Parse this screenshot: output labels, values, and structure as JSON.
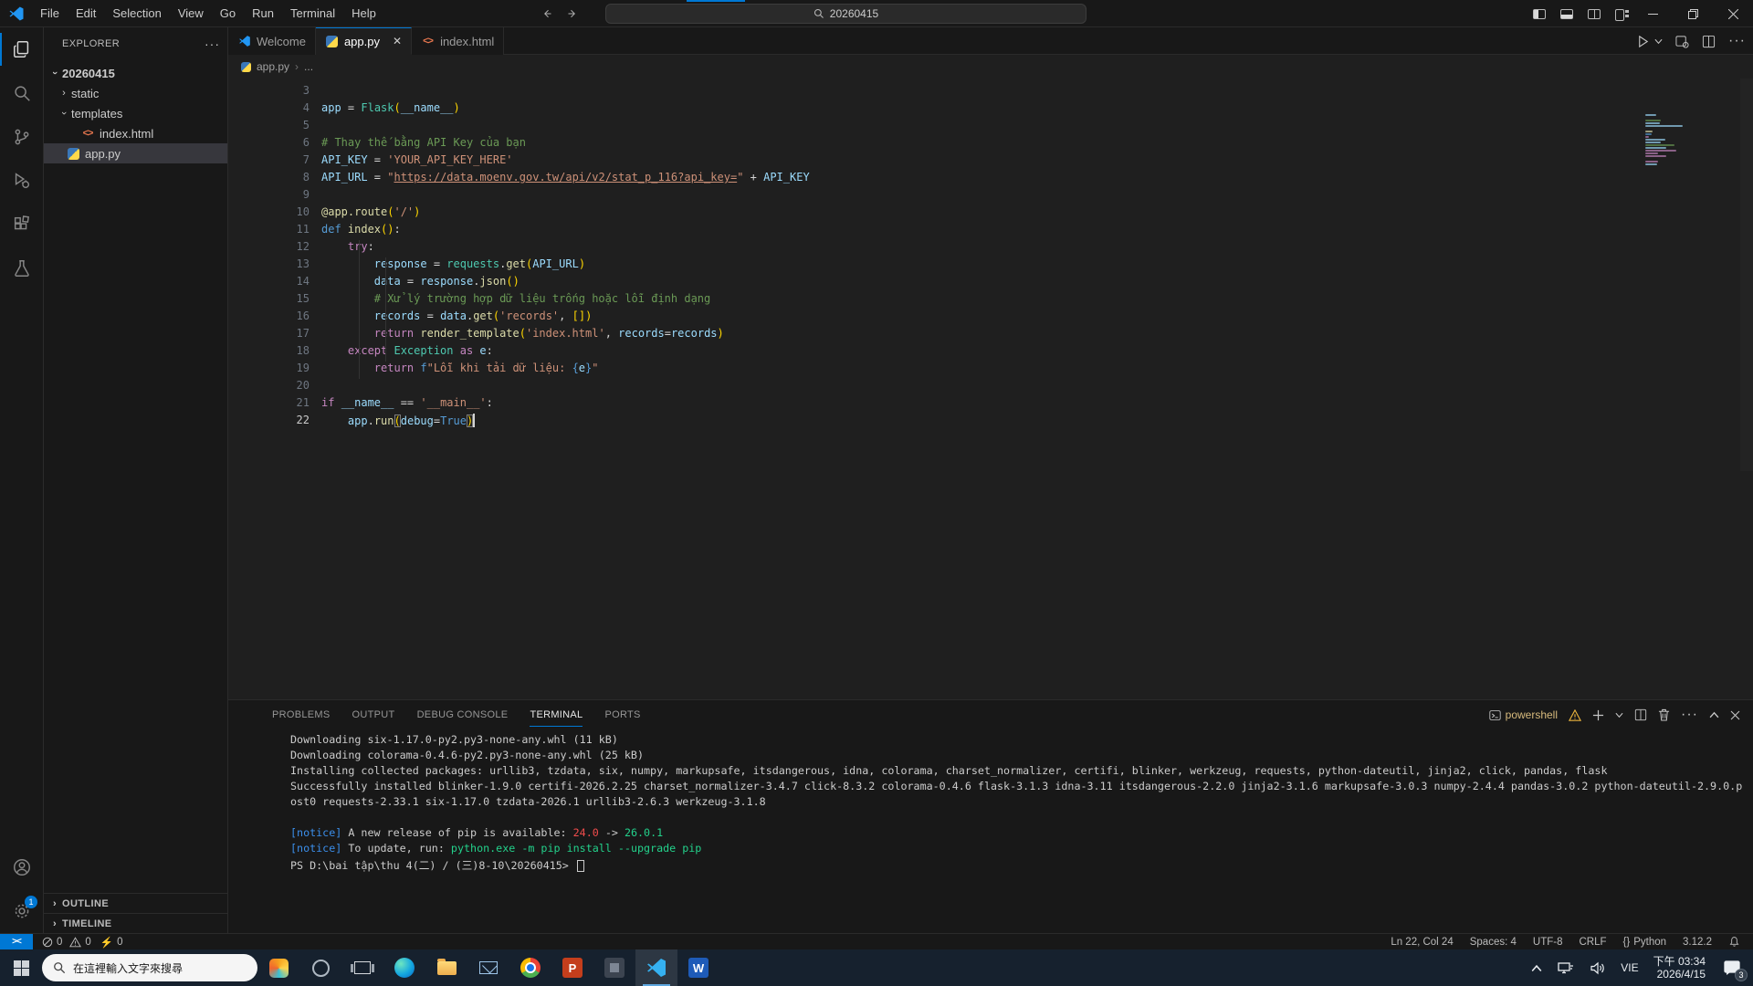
{
  "titlebar": {
    "menus": [
      "File",
      "Edit",
      "Selection",
      "View",
      "Go",
      "Run",
      "Terminal",
      "Help"
    ],
    "command_center_text": "20260415"
  },
  "tabs": [
    {
      "label": "Welcome",
      "icon": "vscode-logo"
    },
    {
      "label": "app.py",
      "icon": "python",
      "active": true
    },
    {
      "label": "index.html",
      "icon": "html"
    }
  ],
  "breadcrumb": {
    "file": "app.py",
    "separator": "›",
    "ellipsis": "..."
  },
  "explorer": {
    "title": "EXPLORER",
    "more": "···",
    "items": [
      {
        "label": "20260415"
      },
      {
        "label": "static"
      },
      {
        "label": "templates"
      },
      {
        "label": "index.html"
      },
      {
        "label": "app.py"
      }
    ]
  },
  "sidebar_sections": {
    "outline": "OUTLINE",
    "timeline": "TIMELINE"
  },
  "editor": {
    "lines": [
      {
        "n": 3,
        "segs": []
      },
      {
        "n": 4,
        "segs": [
          [
            "app",
            "v"
          ],
          [
            " = ",
            "o"
          ],
          [
            "Flask",
            "c"
          ],
          [
            "(",
            "b"
          ],
          [
            "__name__",
            "v"
          ],
          [
            ")",
            "b"
          ]
        ]
      },
      {
        "n": 5,
        "segs": []
      },
      {
        "n": 6,
        "segs": [
          [
            "# Thay thế bằng API Key của bạn",
            "m"
          ]
        ]
      },
      {
        "n": 7,
        "segs": [
          [
            "API_KEY",
            "v"
          ],
          [
            " = ",
            "o"
          ],
          [
            "'YOUR_API_KEY_HERE'",
            "s"
          ]
        ]
      },
      {
        "n": 8,
        "segs": [
          [
            "API_URL",
            "v"
          ],
          [
            " = ",
            "o"
          ],
          [
            "\"",
            "s"
          ],
          [
            "https://data.moenv.gov.tw/api/v2/stat_p_116?api_key=",
            "u"
          ],
          [
            "\"",
            "s"
          ],
          [
            " + ",
            "o"
          ],
          [
            "API_KEY",
            "v"
          ]
        ]
      },
      {
        "n": 9,
        "segs": []
      },
      {
        "n": 10,
        "segs": [
          [
            "@app.route",
            "f"
          ],
          [
            "(",
            "b"
          ],
          [
            "'/'",
            "s"
          ],
          [
            ")",
            "b"
          ]
        ]
      },
      {
        "n": 11,
        "segs": [
          [
            "def ",
            "d"
          ],
          [
            "index",
            "f"
          ],
          [
            "(",
            "b"
          ],
          [
            ")",
            "b"
          ],
          [
            ":",
            "o"
          ]
        ]
      },
      {
        "n": 12,
        "segs": [
          [
            "    ",
            "o"
          ],
          [
            "try",
            "k"
          ],
          [
            ":",
            "o"
          ]
        ]
      },
      {
        "n": 13,
        "segs": [
          [
            "        ",
            "o"
          ],
          [
            "response",
            "v"
          ],
          [
            " = ",
            "o"
          ],
          [
            "requests",
            "c"
          ],
          [
            ".",
            "o"
          ],
          [
            "get",
            "f"
          ],
          [
            "(",
            "b"
          ],
          [
            "API_URL",
            "v"
          ],
          [
            ")",
            "b"
          ]
        ]
      },
      {
        "n": 14,
        "segs": [
          [
            "        ",
            "o"
          ],
          [
            "data",
            "v"
          ],
          [
            " = ",
            "o"
          ],
          [
            "response",
            "v"
          ],
          [
            ".",
            "o"
          ],
          [
            "json",
            "f"
          ],
          [
            "(",
            "b"
          ],
          [
            ")",
            "b"
          ]
        ]
      },
      {
        "n": 15,
        "segs": [
          [
            "        ",
            "o"
          ],
          [
            "# Xử lý trường hợp dữ liệu trống hoặc lỗi định dạng",
            "m"
          ]
        ]
      },
      {
        "n": 16,
        "segs": [
          [
            "        ",
            "o"
          ],
          [
            "records",
            "v"
          ],
          [
            " = ",
            "o"
          ],
          [
            "data",
            "v"
          ],
          [
            ".",
            "o"
          ],
          [
            "get",
            "f"
          ],
          [
            "(",
            "b"
          ],
          [
            "'records'",
            "s"
          ],
          [
            ", ",
            "o"
          ],
          [
            "[]",
            "b"
          ],
          [
            ")",
            "b"
          ]
        ]
      },
      {
        "n": 17,
        "segs": [
          [
            "        ",
            "o"
          ],
          [
            "return ",
            "k"
          ],
          [
            "render_template",
            "f"
          ],
          [
            "(",
            "b"
          ],
          [
            "'index.html'",
            "s"
          ],
          [
            ", ",
            "o"
          ],
          [
            "records",
            "v"
          ],
          [
            "=",
            "o"
          ],
          [
            "records",
            "v"
          ],
          [
            ")",
            "b"
          ]
        ]
      },
      {
        "n": 18,
        "segs": [
          [
            "    ",
            "o"
          ],
          [
            "except ",
            "k"
          ],
          [
            "Exception",
            "c"
          ],
          [
            " as ",
            "k"
          ],
          [
            "e",
            "v"
          ],
          [
            ":",
            "o"
          ]
        ]
      },
      {
        "n": 19,
        "segs": [
          [
            "        ",
            "o"
          ],
          [
            "return ",
            "k"
          ],
          [
            "f",
            "d"
          ],
          [
            "\"Lỗi khi tải dữ liệu: ",
            "s"
          ],
          [
            "{",
            "d"
          ],
          [
            "e",
            "v"
          ],
          [
            "}",
            "d"
          ],
          [
            "\"",
            "s"
          ]
        ]
      },
      {
        "n": 20,
        "segs": []
      },
      {
        "n": 21,
        "segs": [
          [
            "if ",
            "k"
          ],
          [
            "__name__",
            "v"
          ],
          [
            " == ",
            "o"
          ],
          [
            "'__main__'",
            "s"
          ],
          [
            ":",
            "o"
          ]
        ]
      },
      {
        "n": 22,
        "cursor": true,
        "segs": [
          [
            "    ",
            "o"
          ],
          [
            "app",
            "v"
          ],
          [
            ".",
            "o"
          ],
          [
            "run",
            "f"
          ],
          [
            "(",
            "x"
          ],
          [
            "debug",
            "v"
          ],
          [
            "=",
            "o"
          ],
          [
            "True",
            "d"
          ],
          [
            ")",
            "x"
          ]
        ]
      }
    ]
  },
  "panel": {
    "tabs": [
      "PROBLEMS",
      "OUTPUT",
      "DEBUG CONSOLE",
      "TERMINAL",
      "PORTS"
    ],
    "active_tab": "TERMINAL",
    "shell_label": "powershell",
    "terminal_lines": [
      {
        "segs": [
          [
            "Downloading six-1.17.0-py2.py3-none-any.whl (11 kB)",
            "w"
          ]
        ]
      },
      {
        "segs": [
          [
            "Downloading colorama-0.4.6-py2.py3-none-any.whl (25 kB)",
            "w"
          ]
        ]
      },
      {
        "segs": [
          [
            "Installing collected packages: urllib3, tzdata, six, numpy, markupsafe, itsdangerous, idna, colorama, charset_normalizer, certifi, blinker, werkzeug, requests, python-dateutil, jinja2, click, pandas, flask",
            "w"
          ]
        ]
      },
      {
        "segs": [
          [
            "Successfully installed blinker-1.9.0 certifi-2026.2.25 charset_normalizer-3.4.7 click-8.3.2 colorama-0.4.6 flask-3.1.3 idna-3.11 itsdangerous-2.2.0 jinja2-3.1.6 markupsafe-3.0.3 numpy-2.4.4 pandas-3.0.2 python-dateutil-2.9.0.p",
            "w"
          ]
        ]
      },
      {
        "segs": [
          [
            "ost0 requests-2.33.1 six-1.17.0 tzdata-2026.1 urllib3-2.6.3 werkzeug-3.1.8",
            "w"
          ]
        ]
      },
      {
        "segs": []
      },
      {
        "segs": [
          [
            "[notice]",
            "b"
          ],
          [
            " A new release of pip is available: ",
            "w"
          ],
          [
            "24.0",
            "r"
          ],
          [
            " -> ",
            "w"
          ],
          [
            "26.0.1",
            "g"
          ]
        ]
      },
      {
        "segs": [
          [
            "[notice]",
            "b"
          ],
          [
            " To update, run: ",
            "w"
          ],
          [
            "python.exe -m pip install --upgrade pip",
            "g"
          ]
        ]
      },
      {
        "segs": [
          [
            "PS D:\\bai tập\\thu 4(二) / (三)8-10\\20260415> ",
            "w"
          ]
        ],
        "cursor": true
      }
    ]
  },
  "status": {
    "remote_glyph": "><",
    "errors": "0",
    "warnings": "0",
    "ports": "0",
    "line_col": "Ln 22, Col 24",
    "indentation": "Spaces: 4",
    "encoding": "UTF-8",
    "eol": "CRLF",
    "lang_icon": "{}",
    "language": "Python",
    "py_version": "3.12.2"
  },
  "taskbar": {
    "search_placeholder": "在這裡輸入文字來搜尋",
    "ppt_letter": "P",
    "word_letter": "W",
    "tray": {
      "language": "VIE",
      "time": "下午 03:34",
      "date": "2026/4/15",
      "notification_count": "3"
    }
  },
  "colors": {
    "accent": "#0078d4",
    "remote_bg": "#0078d4",
    "notice_blue": "#3b8eea",
    "error_red": "#f14c4c",
    "success_green": "#23d18b",
    "powershell_label": "#d7ba7d",
    "comment_green": "#6a9955",
    "string_orange": "#ce9178"
  }
}
